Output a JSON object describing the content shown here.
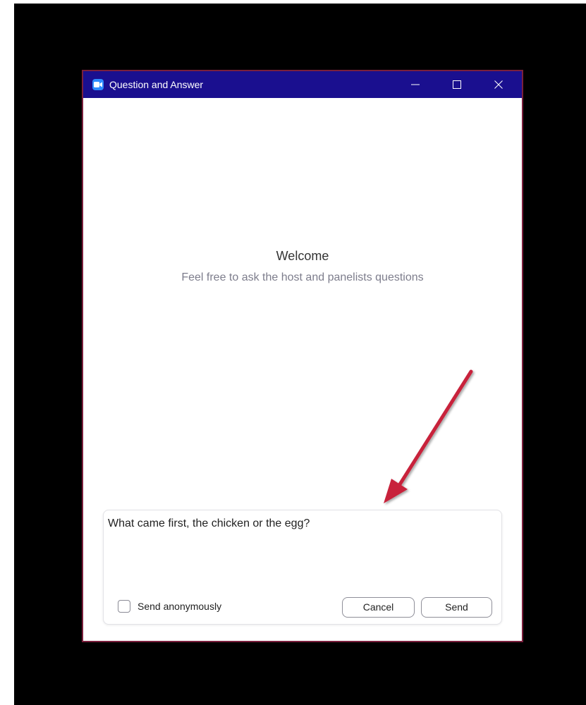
{
  "window": {
    "title": "Question and Answer",
    "controls": {
      "minimize": "minimize-icon",
      "maximize": "maximize-icon",
      "close": "close-icon"
    }
  },
  "welcome": {
    "title": "Welcome",
    "subtitle": "Feel free to ask the host and panelists questions"
  },
  "compose": {
    "question_value": "What came first, the chicken or the egg?",
    "anonymous_label": "Send anonymously",
    "anonymous_checked": false,
    "cancel_label": "Cancel",
    "send_label": "Send"
  },
  "colors": {
    "titlebar": "#1a0f8f",
    "window_border": "#7a1f3c",
    "annotation_arrow": "#c8203a",
    "app_icon": "#2d8cff"
  }
}
